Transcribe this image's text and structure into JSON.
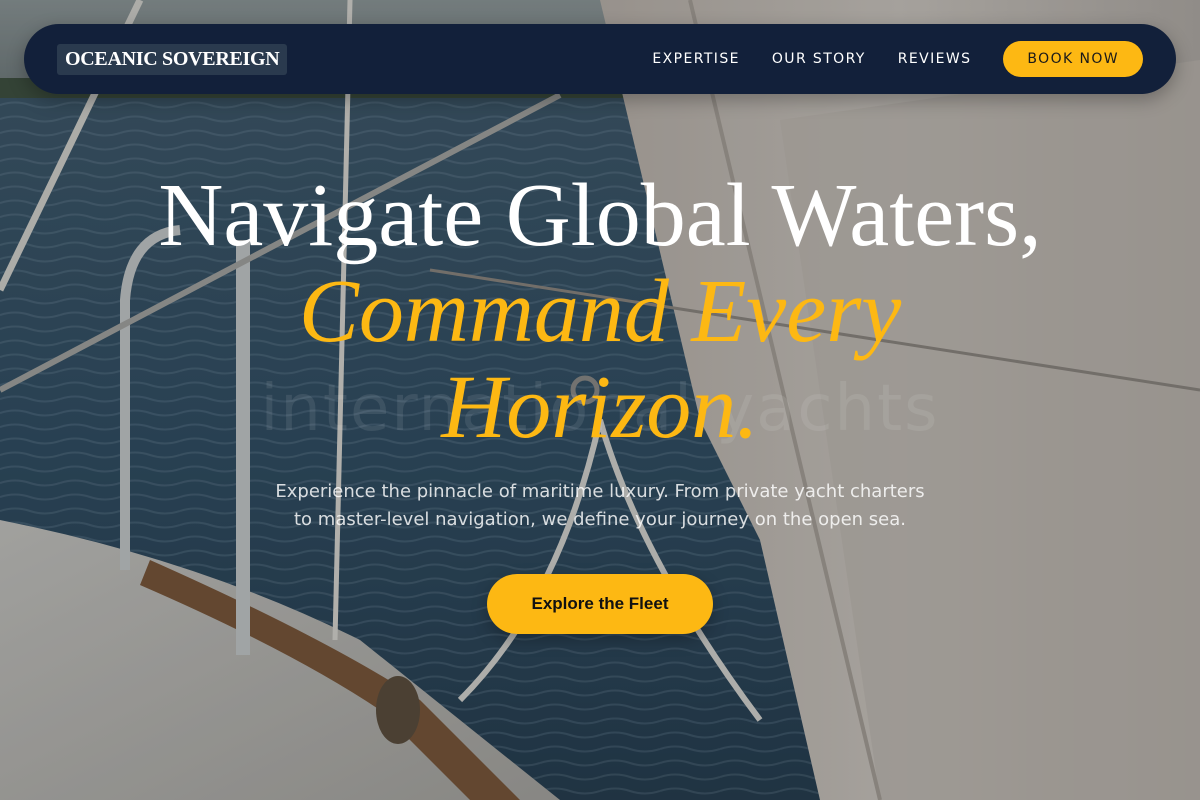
{
  "brand": {
    "name": "OCEANIC SOVEREIGN"
  },
  "nav": {
    "links": [
      {
        "label": "EXPERTISE"
      },
      {
        "label": "OUR STORY"
      },
      {
        "label": "REVIEWS"
      }
    ],
    "cta_label": "BOOK NOW"
  },
  "hero": {
    "headline_line1": "Navigate Global Waters,",
    "headline_accent_line1": "Command Every",
    "headline_accent_line2": "Horizon.",
    "watermark": "international yachts",
    "subtitle_line1": "Experience the pinnacle of maritime luxury. From private yacht charters",
    "subtitle_line2": "to master-level navigation, we define your journey on the open sea.",
    "cta_label": "Explore the Fleet"
  },
  "colors": {
    "navbar_bg": "#12203a",
    "accent": "#fdb813",
    "text_light": "#ffffff",
    "sea": "#2f4a5e"
  }
}
